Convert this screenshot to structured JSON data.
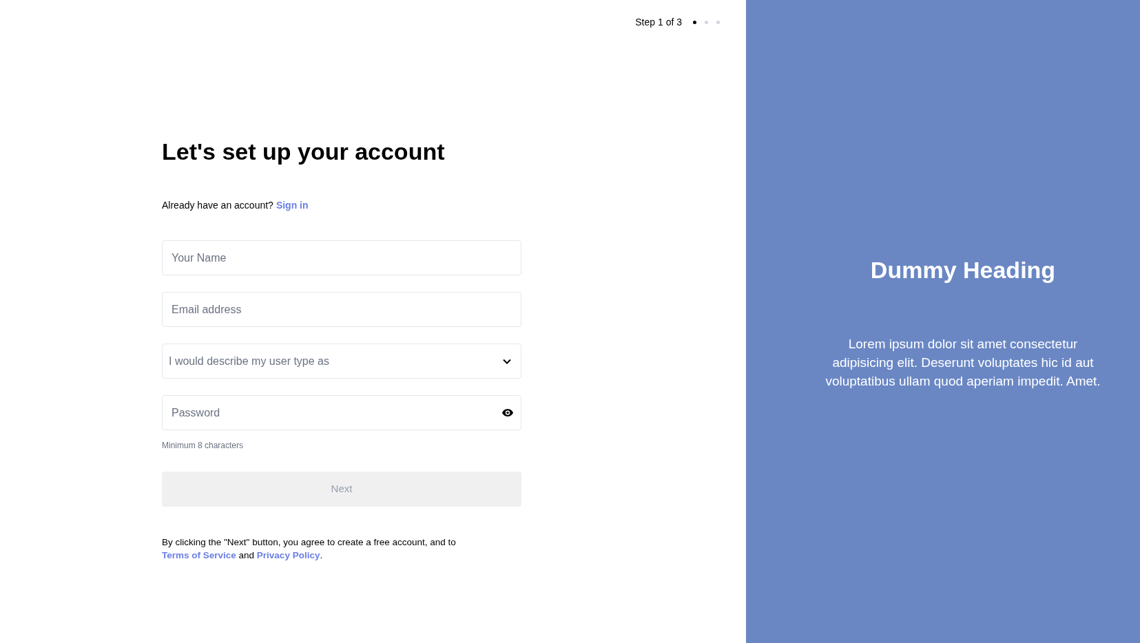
{
  "stepper": {
    "label": "Step 1 of 3",
    "steps": [
      {
        "selected": true
      },
      {
        "selected": false
      },
      {
        "selected": false
      }
    ]
  },
  "form": {
    "title": "Let's set up your account",
    "signin_prompt": {
      "text": "Already have an account?",
      "link": "Sign in"
    },
    "fields": [
      {
        "kind": "text",
        "placeholder": "Your Name"
      },
      {
        "kind": "email",
        "placeholder": "Email address"
      },
      {
        "kind": "select",
        "placeholder": "I would describe my user type as"
      },
      {
        "kind": "password",
        "placeholder": "Password",
        "hint": "Minimum 8 characters"
      }
    ],
    "next_button": {
      "label": "Next",
      "disabled": true
    },
    "terms": {
      "before": "By clicking the \"Next\" button, you agree to create a free account, and to",
      "link_1": "Terms of Service",
      "middle": "and",
      "link_2": "Privacy Policy",
      "after": "."
    }
  },
  "aside": {
    "heading": "Dummy Heading",
    "body": "Lorem ipsum dolor sit amet consectetur adipisicing elit. Deserunt voluptates hic id aut voluptatibus ullam quod aperiam impedit. Amet."
  }
}
